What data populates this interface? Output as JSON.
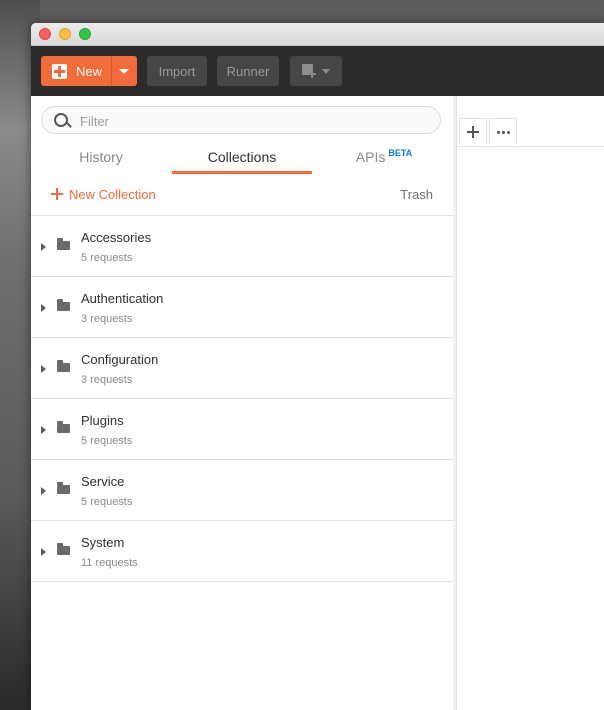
{
  "toolbar": {
    "new_label": "New",
    "import_label": "Import",
    "runner_label": "Runner",
    "accent_color": "#f26b3a"
  },
  "sidebar": {
    "search": {
      "placeholder": "Filter",
      "value": ""
    },
    "tabs": [
      {
        "label": "History",
        "active": false
      },
      {
        "label": "Collections",
        "active": true
      },
      {
        "label": "APIs",
        "badge": "BETA",
        "active": false
      }
    ],
    "new_collection_label": "New Collection",
    "trash_label": "Trash",
    "collections": [
      {
        "name": "Accessories",
        "count": "5 requests"
      },
      {
        "name": "Authentication",
        "count": "3 requests"
      },
      {
        "name": "Configuration",
        "count": "3 requests"
      },
      {
        "name": "Plugins",
        "count": "5 requests"
      },
      {
        "name": "Service",
        "count": "5 requests"
      },
      {
        "name": "System",
        "count": "11 requests"
      }
    ]
  },
  "icons": {
    "search": "search-icon",
    "new_window": "new-window-icon",
    "folder": "folder-icon",
    "expand": "caret-right-icon",
    "add_tab": "plus-icon",
    "more": "more-icon"
  }
}
